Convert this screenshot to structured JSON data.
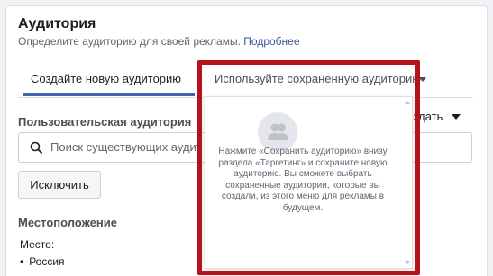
{
  "header": {
    "title": "Аудитория",
    "subtitle": "Определите аудиторию для своей рекламы.",
    "learn_more": "Подробнее"
  },
  "tabs": [
    {
      "label": "Создайте новую аудиторию",
      "active": true
    },
    {
      "label": "Используйте сохраненную аудиторию",
      "active": false
    }
  ],
  "custom_audience": {
    "label": "Пользовательская аудитория",
    "create_label": "Создать",
    "search_placeholder": "Поиск существующих аудит",
    "exclude_label": "Исключить"
  },
  "location": {
    "label": "Местоположение",
    "place_label": "Место:",
    "items": [
      "Россия"
    ]
  },
  "saved_popup": {
    "icon": "people-icon",
    "text": "Нажмите «Сохранить аудиторию» внизу раздела «Таргетинг» и сохраните новую аудиторию. Вы сможете выбрать сохраненные аудитории, которые вы создали, из этого меню для рекламы в будущем."
  },
  "colors": {
    "accent": "#4267b2",
    "link": "#385898",
    "highlight_frame": "#b5121b"
  }
}
